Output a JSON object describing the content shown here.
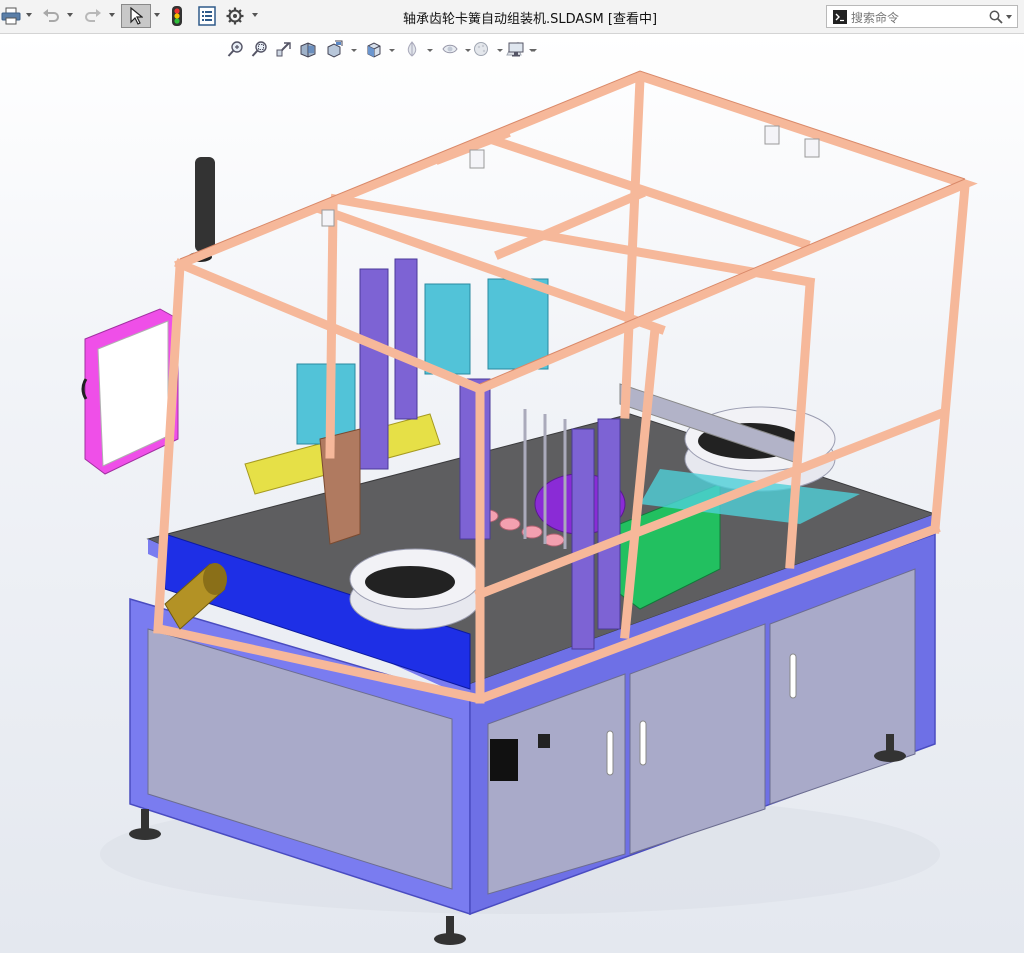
{
  "window": {
    "title": "轴承齿轮卡簧自动组装机.SLDASM [查看中]"
  },
  "toolbar": {
    "items": [
      {
        "icon": "print-icon",
        "has_dropdown": true
      },
      {
        "icon": "undo-icon",
        "has_dropdown": true
      },
      {
        "icon": "redo-icon",
        "has_dropdown": true
      },
      {
        "icon": "select-pointer-icon",
        "has_dropdown": true,
        "active": true
      },
      {
        "icon": "traffic-light-icon",
        "has_dropdown": false
      },
      {
        "icon": "file-properties-icon",
        "has_dropdown": false
      },
      {
        "icon": "gear-icon",
        "has_dropdown": true
      }
    ]
  },
  "search": {
    "prompt_icon": "command-prompt-icon",
    "placeholder": "搜索命令",
    "icon": "search-icon"
  },
  "heads_up_toolbar": {
    "items": [
      "zoom-to-fit-icon",
      "zoom-to-area-icon",
      "previous-view-icon",
      "section-view-icon",
      "dynamic-annotation-icon",
      "view-orientation-icon",
      "display-style-icon",
      "hide-show-items-icon",
      "edit-appearance-icon",
      "apply-scene-icon",
      "view-settings-icon"
    ]
  },
  "model": {
    "name": "assembly-machine-model",
    "colors": {
      "frame": "#f6b89a",
      "frame_edge": "#d98868",
      "base": "#7a7cf0",
      "base_dark": "#5a5cd8",
      "panel": "#a9aac9",
      "bed": "#5e5e60",
      "blue_plate": "#1e2fe6",
      "cabinet": "#ef4fe8",
      "cylinder": "#52c3d8",
      "purple": "#7d63d4",
      "yellow": "#e6e047",
      "green": "#22c060",
      "feeder": "#b2b3c8"
    }
  }
}
